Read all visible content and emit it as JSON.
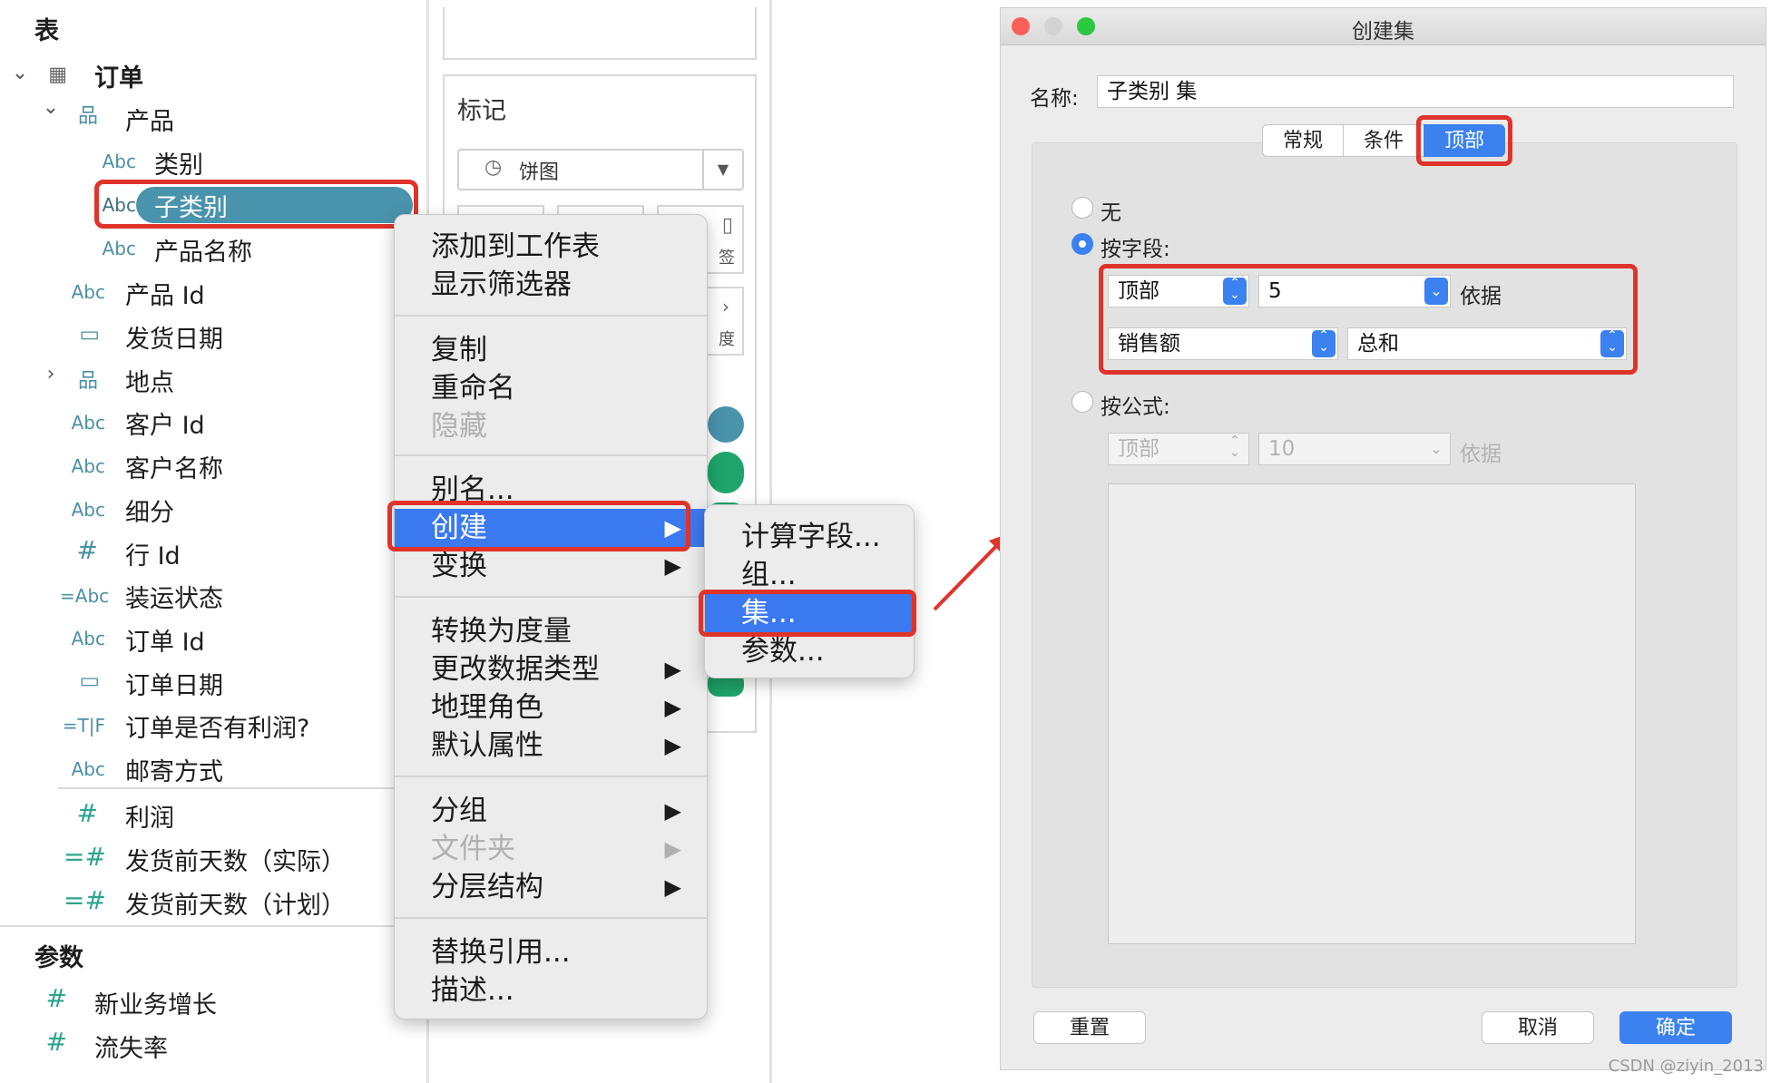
{
  "left_pane": {
    "section_tables": "表",
    "table_name": "订单",
    "folder_product": "产品",
    "fields": [
      {
        "type": "Abc",
        "label": "类别"
      },
      {
        "type": "Abc",
        "label": "子类别"
      },
      {
        "type": "Abc",
        "label": "产品名称"
      },
      {
        "type": "Abc",
        "label": "产品 Id"
      },
      {
        "type": "date",
        "label": "发货日期"
      },
      {
        "type": "hier",
        "label": "地点"
      },
      {
        "type": "Abc",
        "label": "客户 Id"
      },
      {
        "type": "Abc",
        "label": "客户名称"
      },
      {
        "type": "Abc",
        "label": "细分"
      },
      {
        "type": "#",
        "label": "行 Id"
      },
      {
        "type": "=Abc",
        "label": "装运状态"
      },
      {
        "type": "Abc",
        "label": "订单 Id"
      },
      {
        "type": "date",
        "label": "订单日期"
      },
      {
        "type": "=T|F",
        "label": "订单是否有利润?"
      },
      {
        "type": "Abc",
        "label": "邮寄方式"
      }
    ],
    "measures": [
      {
        "type": "#",
        "label": "利润"
      },
      {
        "type": "=#",
        "label": "发货前天数（实际）"
      },
      {
        "type": "=#",
        "label": "发货前天数（计划）"
      }
    ],
    "section_params": "参数",
    "params": [
      {
        "type": "#",
        "label": "新业务增长"
      },
      {
        "type": "#",
        "label": "流失率"
      }
    ],
    "icon_abc": "Abc",
    "icon_num": "#",
    "icon_calc_num": "=#",
    "icon_calc_abc": "=Abc",
    "icon_tf": "=T|F"
  },
  "marks": {
    "title": "标记",
    "mark_type": "饼图",
    "card_label_partial": "签",
    "card_label_partial2": "度"
  },
  "context_menu": {
    "items": [
      "添加到工作表",
      "显示筛选器",
      "复制",
      "重命名",
      "隐藏",
      "别名...",
      "创建",
      "变换",
      "转换为度量",
      "更改数据类型",
      "地理角色",
      "默认属性",
      "分组",
      "文件夹",
      "分层结构",
      "替换引用...",
      "描述..."
    ]
  },
  "submenu": {
    "items": [
      "计算字段...",
      "组...",
      "集...",
      "参数..."
    ]
  },
  "dialog": {
    "title": "创建集",
    "name_label": "名称:",
    "name_value": "子类别 集",
    "tabs": [
      "常规",
      "条件",
      "顶部"
    ],
    "radio_none": "无",
    "radio_by_field": "按字段:",
    "top_select": "顶部",
    "count_value": "5",
    "by_label": "依据",
    "field_select": "销售额",
    "agg_select": "总和",
    "radio_by_formula": "按公式:",
    "formula_top": "顶部",
    "formula_count": "10",
    "formula_by": "依据",
    "reset": "重置",
    "cancel": "取消",
    "ok": "确定"
  },
  "watermark": "CSDN @ziyin_2013",
  "colors": {
    "highlight": "#e0332a",
    "accent": "#3b79f0",
    "pill": "#4a93ad"
  }
}
